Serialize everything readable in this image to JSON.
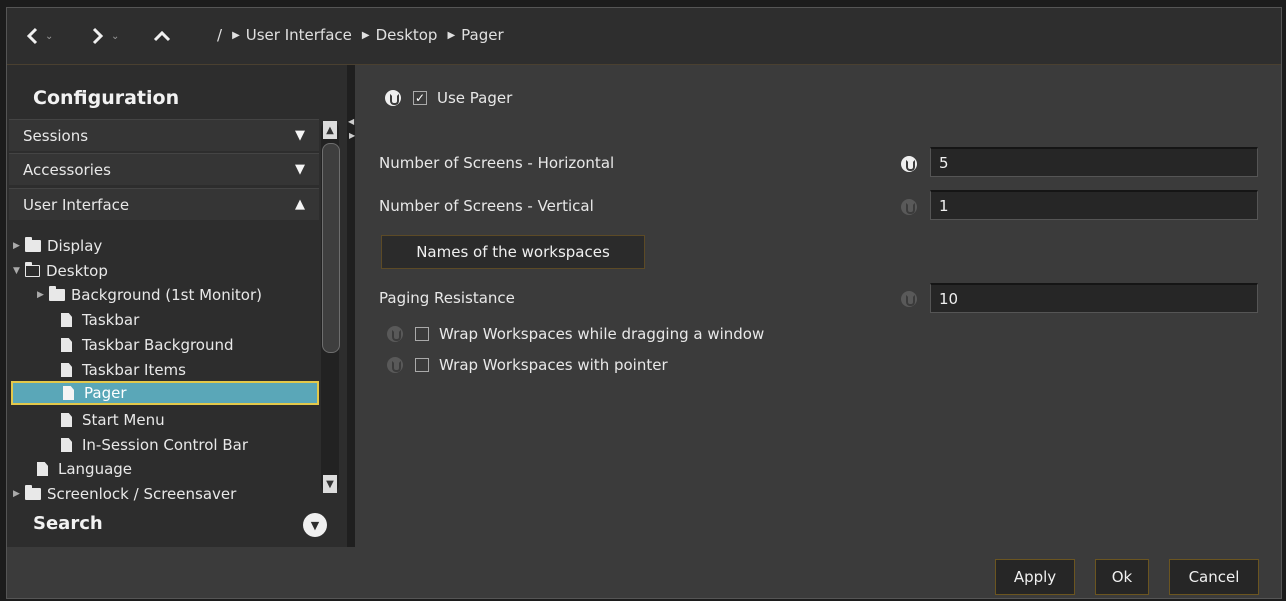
{
  "breadcrumb": {
    "root": "/",
    "items": [
      "User Interface",
      "Desktop",
      "Pager"
    ]
  },
  "sidebar": {
    "title": "Configuration",
    "sections": [
      {
        "label": "Sessions",
        "state": "collapsed"
      },
      {
        "label": "Accessories",
        "state": "collapsed"
      },
      {
        "label": "User Interface",
        "state": "expanded"
      }
    ],
    "tree": {
      "display": "Display",
      "desktop": "Desktop",
      "background": "Background (1st Monitor)",
      "taskbar": "Taskbar",
      "taskbar_background": "Taskbar Background",
      "taskbar_items": "Taskbar Items",
      "pager": "Pager",
      "start_menu": "Start Menu",
      "in_session": "In-Session Control Bar",
      "language": "Language",
      "screenlock": "Screenlock / Screensaver"
    },
    "search_label": "Search"
  },
  "main": {
    "use_pager": {
      "label": "Use Pager",
      "checked": true
    },
    "screens_h": {
      "label": "Number of Screens - Horizontal",
      "value": "5"
    },
    "screens_v": {
      "label": "Number of Screens - Vertical",
      "value": "1"
    },
    "names_button": "Names of the workspaces",
    "paging_resistance": {
      "label": "Paging Resistance",
      "value": "10"
    },
    "wrap_drag": {
      "label": "Wrap Workspaces while dragging a window",
      "checked": false
    },
    "wrap_pointer": {
      "label": "Wrap Workspaces with pointer",
      "checked": false
    }
  },
  "footer": {
    "apply": "Apply",
    "ok": "Ok",
    "cancel": "Cancel"
  },
  "colors": {
    "selection": "#5aa7b8",
    "selection_border": "#e3c84a",
    "button_border": "#6b5520"
  }
}
